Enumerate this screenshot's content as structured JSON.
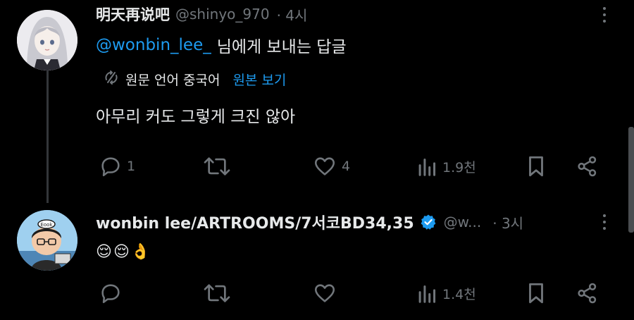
{
  "tweets": [
    {
      "name": "明天再说吧",
      "handle": "@shinyo_970",
      "time": "· 4시",
      "reply_mention": "@wonbin_lee_",
      "reply_suffix": "님에게 보내는 답글",
      "translate_label": "원문 언어 중국어",
      "translate_link": "원본 보기",
      "text": "아무리 커도 그렇게 크진 않아",
      "reply_count": "1",
      "retweet_count": "",
      "like_count": "4",
      "view_count": "1.9천"
    },
    {
      "name": "wonbin lee/ARTROOMS/7서코BD34,35",
      "handle": "@w...",
      "time": "· 3시",
      "text_emojis": [
        "😌",
        "😌",
        "👌"
      ],
      "reply_count": "",
      "retweet_count": "",
      "like_count": "",
      "view_count": "1.4천"
    }
  ],
  "icons": {
    "reply": "reply-bubble-icon",
    "retweet": "retweet-icon",
    "like": "heart-icon",
    "views": "views-bar-chart-icon",
    "bookmark": "bookmark-icon",
    "share": "share-icon",
    "translate": "translate-icon",
    "verified": "verified-badge-icon",
    "more": "more-options-icon"
  },
  "colors": {
    "background": "#000000",
    "text": "#e7e9ea",
    "muted": "#71767b",
    "accent": "#1d9bf0"
  }
}
